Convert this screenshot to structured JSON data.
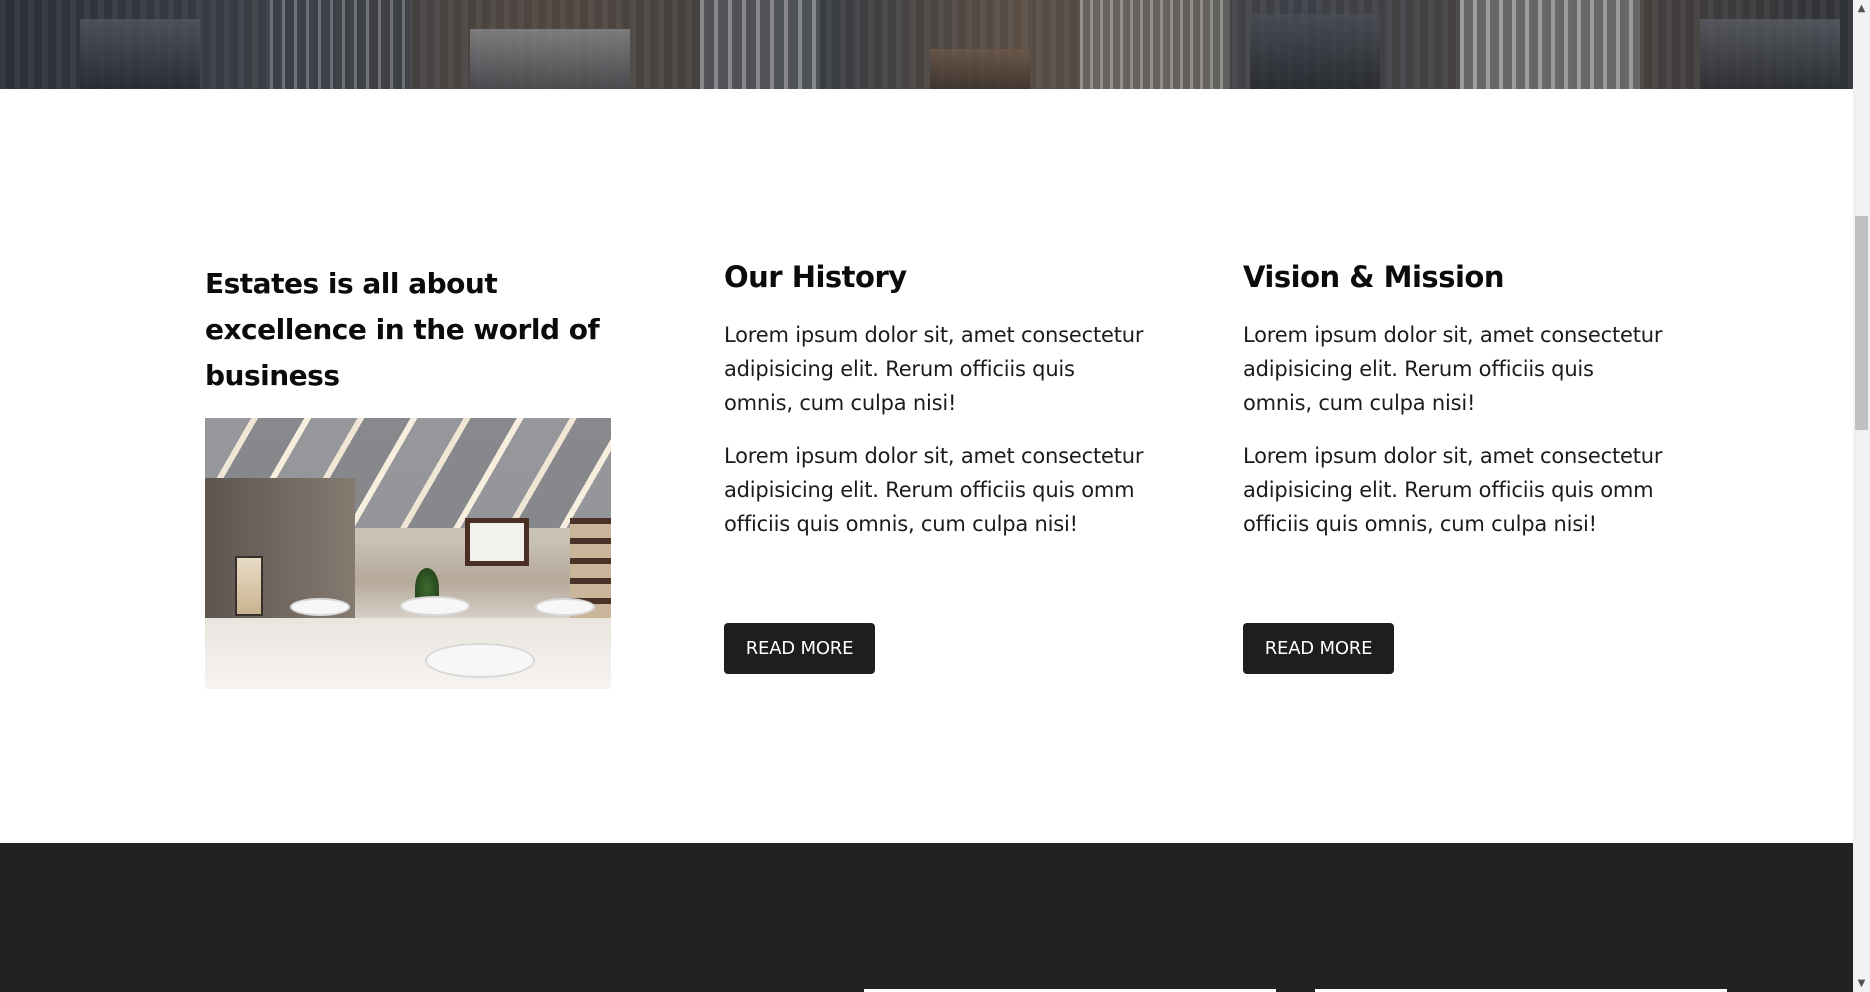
{
  "about": {
    "lead_title": "Estates is all about excellence in the world of business"
  },
  "columns": [
    {
      "title": "Our History",
      "paragraphs": [
        "Lorem ipsum dolor sit, amet consectetur adipisicing elit. Rerum officiis quis omnis, cum culpa nisi!",
        "Lorem ipsum dolor sit, amet consectetur adipisicing elit. Rerum officiis quis omm officiis quis omnis, cum culpa nisi!"
      ],
      "button_label": "READ MORE"
    },
    {
      "title": "Vision & Mission",
      "paragraphs": [
        "Lorem ipsum dolor sit, amet consectetur adipisicing elit. Rerum officiis quis omnis, cum culpa nisi!",
        "Lorem ipsum dolor sit, amet consectetur adipisicing elit. Rerum officiis quis omm officiis quis omnis, cum culpa nisi!"
      ],
      "button_label": "READ MORE"
    }
  ],
  "scrollbar": {
    "up_icon": "▲",
    "down_icon": "▼"
  },
  "colors": {
    "button_bg": "#1e1e1e",
    "footer_bg": "#222222",
    "text": "#0b0b0b"
  }
}
